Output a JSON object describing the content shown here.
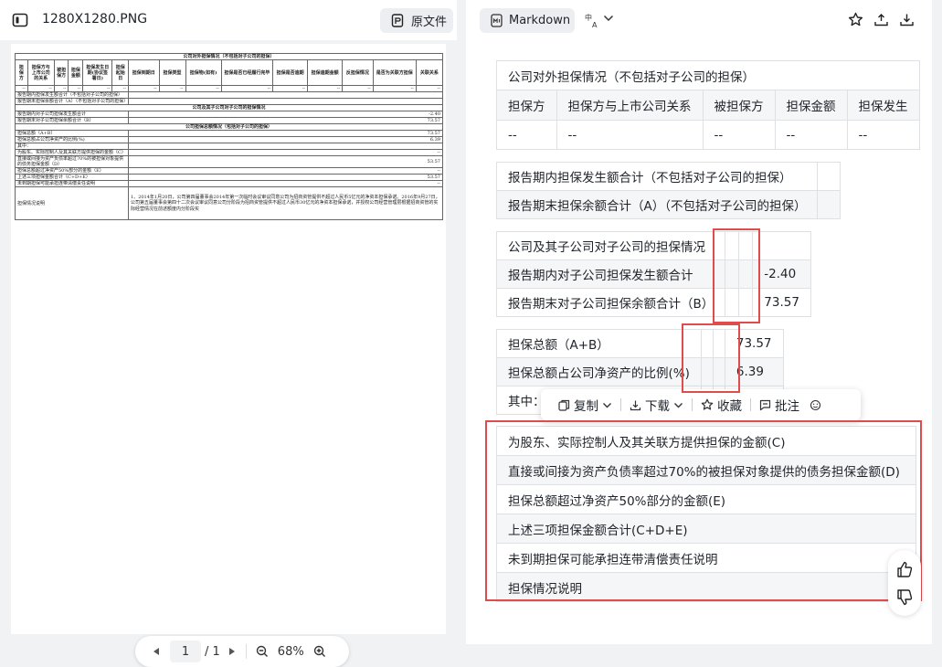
{
  "left_panel": {
    "file_name": "1280X1280.PNG",
    "original_button": "原文件"
  },
  "right_panel": {
    "format": "Markdown"
  },
  "pdf": {
    "title1": "公司对外担保情况（不包括对子公司的担保）",
    "headers": [
      "担保方",
      "担保方与上市公司的关系",
      "被担保方",
      "担保金额",
      "担保发生日期(协议签署日)",
      "担保起始日",
      "担保到期日",
      "担保类型",
      "担保物(如有)",
      "担保是否已经履行完毕",
      "担保是否逾期",
      "担保逾期金额",
      "反担保情况",
      "是否为关联方担保",
      "关联关系"
    ],
    "dash": "--",
    "rows_a": [
      {
        "label": "报告期内担保发生额合计（不包括对子公司的担保）",
        "value": ""
      },
      {
        "label": "报告期末担保余额合计（A）（不包括对子公司的担保）",
        "value": ""
      }
    ],
    "title2": "公司及其子公司对子公司的担保情况",
    "rows_b": [
      {
        "label": "报告期内对子公司担保发生额合计",
        "value": "-2.40"
      },
      {
        "label": "报告期末对子公司担保余额合计（B）",
        "value": "73.57"
      }
    ],
    "title3": "公司担保总额情况（包括对子公司的担保）",
    "rows_c": [
      {
        "label": "担保总额（A+B）",
        "value": "73.57"
      },
      {
        "label": "担保总额占公司净资产的比例(%)",
        "value": "6.39"
      },
      {
        "label": "其中：",
        "value": ""
      },
      {
        "label": "为股东、实际控制人及其关联方提供担保的金额（C）",
        "value": "--"
      },
      {
        "label": "直接或间接为资产负债率超过70%的被担保对象提供的债务担保金额（D）",
        "value": "53.57"
      },
      {
        "label": "担保总额超过净资产50%部分的金额（E）",
        "value": "--"
      },
      {
        "label": "上述三项担保金额合计（C+D+E）",
        "value": "53.57"
      },
      {
        "label": "未到期担保可能承担连带清偿责任说明",
        "value": "--"
      }
    ],
    "note_label": "担保情况说明",
    "note_text": "1、2014年1月20日，公司第四届董事会2014年第一次临时会议审议同意公司为招商资管提供不超过人民币5亿元的净资本担保承诺。2016年9月27日，公司第五届董事会第四十二次会议审议同意公司分阶段为招商资管提供不超过人民币30亿元的净资本担保承诺，并授权公司经营管理层根据招商资管的实际经营情况在前述额度内分阶段实"
  },
  "pager": {
    "page": "1",
    "total": "/ 1",
    "zoom": "68%"
  },
  "md": {
    "t1_title": "公司对外担保情况（不包括对子公司的担保）",
    "t1_headers": [
      "担保方",
      "担保方与上市公司关系",
      "被担保方",
      "担保金额",
      "担保发生"
    ],
    "t1_row": [
      "--",
      "--",
      "--",
      "--",
      "--"
    ],
    "t2": [
      "报告期内担保发生额合计（不包括对子公司的担保）",
      "报告期末担保余额合计（A）（不包括对子公司的担保）"
    ],
    "t3_title": "公司及其子公司对子公司的担保情况",
    "t3": [
      {
        "label": "报告期内对子公司担保发生额合计",
        "value": "-2.40"
      },
      {
        "label": "报告期末对子公司担保余额合计（B）",
        "value": "73.57"
      }
    ],
    "t4": [
      {
        "label": "担保总额（A+B）",
        "value": "73.57"
      },
      {
        "label": "担保总额占公司净资产的比例(%)",
        "value": "6.39"
      },
      {
        "label": "其中：",
        "value": ""
      }
    ],
    "t5": [
      "为股东、实际控制人及其关联方提供担保的金额(C)",
      "直接或间接为资产负债率超过70%的被担保对象提供的债务担保金额(D)",
      "担保总额超过净资产50%部分的金额(E)",
      "上述三项担保金额合计(C+D+E)",
      "未到期担保可能承担连带清偿责任说明",
      "担保情况说明"
    ]
  },
  "toolbar": {
    "copy": "复制",
    "download": "下载",
    "favorite": "收藏",
    "comment": "批注"
  },
  "colors": {
    "highlight": "#e04b4b",
    "accent": "#5a67d8"
  }
}
